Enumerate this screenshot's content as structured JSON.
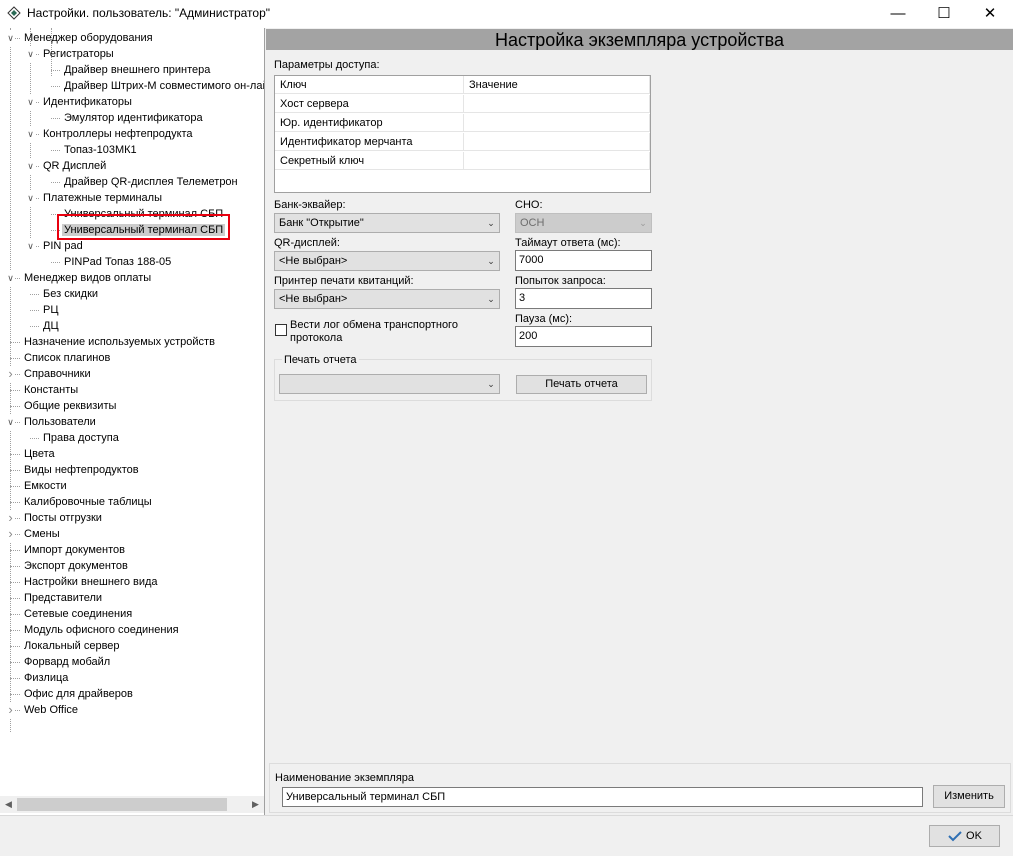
{
  "window": {
    "title": "Настройки. пользователь: \"Администратор\"",
    "minimize": "—",
    "maximize": "☐",
    "close": "✕"
  },
  "tree": {
    "items": [
      {
        "label": "Менеджер оборудования",
        "level": 0,
        "expander": "expanded"
      },
      {
        "label": "Регистраторы",
        "level": 1,
        "expander": "expanded"
      },
      {
        "label": "Драйвер внешнего принтера",
        "level": 2,
        "expander": "none"
      },
      {
        "label": "Драйвер Штрих-М совместимого он-лай",
        "level": 2,
        "expander": "none"
      },
      {
        "label": "Идентификаторы",
        "level": 1,
        "expander": "expanded"
      },
      {
        "label": "Эмулятор идентификатора",
        "level": 2,
        "expander": "none"
      },
      {
        "label": "Контроллеры нефтепродукта",
        "level": 1,
        "expander": "expanded"
      },
      {
        "label": "Топаз-103МК1",
        "level": 2,
        "expander": "none"
      },
      {
        "label": "QR Дисплей",
        "level": 1,
        "expander": "expanded"
      },
      {
        "label": "Драйвер QR-дисплея Телеметрон",
        "level": 2,
        "expander": "none"
      },
      {
        "label": "Платежные терминалы",
        "level": 1,
        "expander": "expanded"
      },
      {
        "label": "Универсальный терминал СБП",
        "level": 2,
        "expander": "none"
      },
      {
        "label": "Универсальный терминал СБП",
        "level": 2,
        "expander": "none",
        "selected": true
      },
      {
        "label": "PIN pad",
        "level": 1,
        "expander": "expanded"
      },
      {
        "label": "PINPad Топаз 188-05",
        "level": 2,
        "expander": "none"
      },
      {
        "label": "Менеджер видов оплаты",
        "level": 0,
        "expander": "expanded"
      },
      {
        "label": "Без скидки",
        "level": 1,
        "expander": "none"
      },
      {
        "label": "РЦ",
        "level": 1,
        "expander": "none"
      },
      {
        "label": "ДЦ",
        "level": 1,
        "expander": "none"
      },
      {
        "label": "Назначение используемых устройств",
        "level": 0,
        "expander": "none"
      },
      {
        "label": "Список плагинов",
        "level": 0,
        "expander": "none"
      },
      {
        "label": "Справочники",
        "level": 0,
        "expander": "collapsed"
      },
      {
        "label": "Константы",
        "level": 0,
        "expander": "none"
      },
      {
        "label": "Общие реквизиты",
        "level": 0,
        "expander": "none"
      },
      {
        "label": "Пользователи",
        "level": 0,
        "expander": "expanded"
      },
      {
        "label": "Права доступа",
        "level": 1,
        "expander": "none"
      },
      {
        "label": "Цвета",
        "level": 0,
        "expander": "none"
      },
      {
        "label": "Виды нефтепродуктов",
        "level": 0,
        "expander": "none"
      },
      {
        "label": "Емкости",
        "level": 0,
        "expander": "none"
      },
      {
        "label": "Калибровочные таблицы",
        "level": 0,
        "expander": "none"
      },
      {
        "label": "Посты отгрузки",
        "level": 0,
        "expander": "collapsed"
      },
      {
        "label": "Смены",
        "level": 0,
        "expander": "collapsed"
      },
      {
        "label": "Импорт документов",
        "level": 0,
        "expander": "none"
      },
      {
        "label": "Экспорт документов",
        "level": 0,
        "expander": "none"
      },
      {
        "label": "Настройки внешнего вида",
        "level": 0,
        "expander": "none"
      },
      {
        "label": "Представители",
        "level": 0,
        "expander": "none"
      },
      {
        "label": "Сетевые соединения",
        "level": 0,
        "expander": "none"
      },
      {
        "label": "Модуль офисного соединения",
        "level": 0,
        "expander": "none"
      },
      {
        "label": "Локальный сервер",
        "level": 0,
        "expander": "none"
      },
      {
        "label": "Форвард мобайл",
        "level": 0,
        "expander": "none"
      },
      {
        "label": "Физлица",
        "level": 0,
        "expander": "none"
      },
      {
        "label": "Офис для драйверов",
        "level": 0,
        "expander": "none"
      },
      {
        "label": "Web Office",
        "level": 0,
        "expander": "collapsed"
      }
    ]
  },
  "panel": {
    "header": "Настройка экземпляра устройства",
    "access_params": {
      "label": "Параметры доступа:",
      "columns": [
        "Ключ",
        "Значение"
      ],
      "rows": [
        {
          "key": "Хост сервера",
          "value": ""
        },
        {
          "key": "Юр. идентификатор",
          "value": ""
        },
        {
          "key": "Идентификатор мерчанта",
          "value": ""
        },
        {
          "key": "Секретный ключ",
          "value": ""
        }
      ]
    },
    "bank": {
      "label": "Банк-эквайер:",
      "value": "Банк \"Открытие\""
    },
    "sno": {
      "label": "СНО:",
      "value": "ОСН"
    },
    "qr_display": {
      "label": "QR-дисплей:",
      "value": "<Не выбран>"
    },
    "timeout": {
      "label": "Таймаут ответа (мс):",
      "value": "7000"
    },
    "receipt_printer": {
      "label": "Принтер печати квитанций:",
      "value": "<Не выбран>"
    },
    "attempts": {
      "label": "Попыток запроса:",
      "value": "3"
    },
    "log_checkbox": {
      "label": "Вести лог обмена транспортного протокола",
      "checked": false
    },
    "pause": {
      "label": "Пауза (мс):",
      "value": "200"
    },
    "report": {
      "label": "Печать отчета",
      "select_value": "",
      "button": "Печать отчета"
    },
    "instance_name": {
      "label": "Наименование экземпляра",
      "value": "Универсальный терминал СБП",
      "button": "Изменить"
    }
  },
  "footer": {
    "ok": "OK"
  },
  "colors": {
    "highlight": "#e8000f",
    "header_bg": "#a3a3a3",
    "selected_bg": "#cccccc"
  }
}
